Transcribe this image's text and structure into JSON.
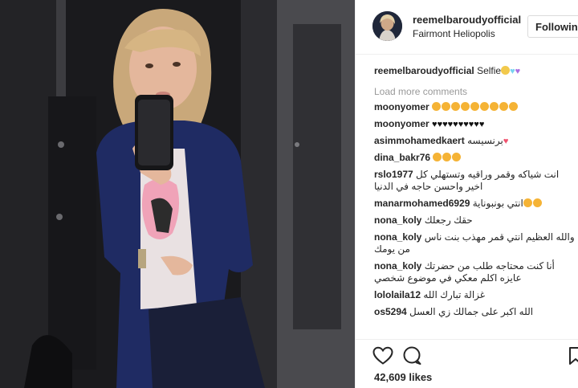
{
  "post": {
    "username": "reemelbaroudyofficial",
    "location": "Fairmont Heliopolis",
    "follow_label": "Following",
    "caption_user": "reemelbaroudyofficial",
    "caption_text": "Selfie",
    "load_more": "Load more comments",
    "likes": "42,609 likes"
  },
  "comments": [
    {
      "user": "moonyomer",
      "text": "",
      "emoji": [
        "heart-eyes-face",
        "heart-eyes-face",
        "heart-eyes-face",
        "heart-eyes-face",
        "heart-eyes-face",
        "heart-eyes-face",
        "heart-eyes-face",
        "heart-eyes-face",
        "heart-eyes-face"
      ]
    },
    {
      "user": "moonyomer",
      "text": "",
      "emoji": [
        "black-heart",
        "black-heart",
        "black-heart",
        "black-heart",
        "black-heart",
        "black-heart",
        "black-heart",
        "black-heart",
        "black-heart",
        "black-heart"
      ]
    },
    {
      "user": "asimmohamedkaert",
      "text": "برنسيسه",
      "emoji": [
        "pink-heart"
      ]
    },
    {
      "user": "dina_bakr76",
      "text": "",
      "emoji": [
        "heart-eyes-face",
        "heart-eyes-face",
        "heart-eyes-face"
      ]
    },
    {
      "user": "rslo1977",
      "text": "انت شياكه وقمر وراقيه وتستهلي كل اخير واحسن حاجه في الدنيا",
      "emoji": []
    },
    {
      "user": "manarmohamed6929",
      "text": "انتي بونبوناية",
      "emoji": [
        "heart-eyes-face",
        "heart-eyes-face"
      ]
    },
    {
      "user": "nona_koly",
      "text": "حقك رجعلك",
      "emoji": []
    },
    {
      "user": "nona_koly",
      "text": "والله العظيم انتي قمر مهذب بنت ناس من يومك",
      "emoji": []
    },
    {
      "user": "nona_koly",
      "text": "أنا كنت محتاجه طلب من حضرتك عايزه اكلم معكي في موضوع شخصي",
      "emoji": []
    },
    {
      "user": "lololaila12",
      "text": "غزالة تبارك الله",
      "emoji": []
    },
    {
      "user": "os5294",
      "text": "الله اكبر على جمالك زي العسل",
      "emoji": []
    }
  ],
  "icons": {
    "caption_emoji": [
      "woman-emoji",
      "light-blue-heart",
      "purple-heart"
    ],
    "actions": [
      "like-heart-icon",
      "comment-icon",
      "save-bookmark-icon"
    ]
  },
  "colors": {
    "heart_eyes": "#f5b335",
    "pink_heart": "#f0526e",
    "light_blue_heart": "#7ad3f0",
    "purple_heart": "#a970e0",
    "muted_text": "#999999",
    "border": "#efefef"
  }
}
